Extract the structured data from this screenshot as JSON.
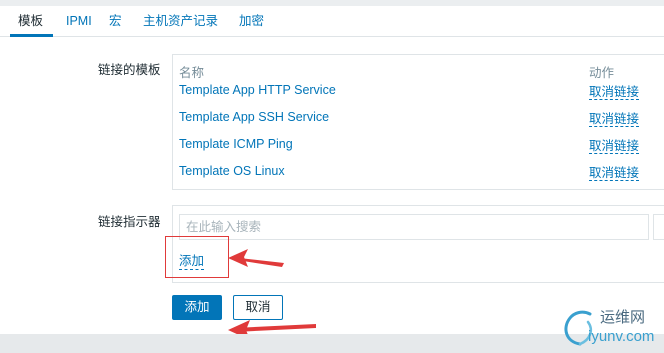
{
  "tabs": [
    {
      "label": "模板",
      "active": true
    },
    {
      "label": "IPMI"
    },
    {
      "label": "宏"
    },
    {
      "label": "主机资产记录"
    },
    {
      "label": "加密"
    }
  ],
  "linked_templates": {
    "label": "链接的模板",
    "col_name": "名称",
    "col_action": "动作",
    "rows": [
      {
        "name": "Template App HTTP Service",
        "action": "取消链接"
      },
      {
        "name": "Template App SSH Service",
        "action": "取消链接"
      },
      {
        "name": "Template ICMP Ping",
        "action": "取消链接"
      },
      {
        "name": "Template OS Linux",
        "action": "取消链接"
      }
    ]
  },
  "link_indicator": {
    "label": "链接指示器",
    "search_placeholder": "在此输入搜索",
    "add_link": "添加"
  },
  "buttons": {
    "add": "添加",
    "cancel": "取消"
  },
  "watermark": {
    "title": "运维网",
    "url": "iyunv.com"
  },
  "colors": {
    "accent": "#0275b8",
    "annotation": "#e03a3a"
  }
}
